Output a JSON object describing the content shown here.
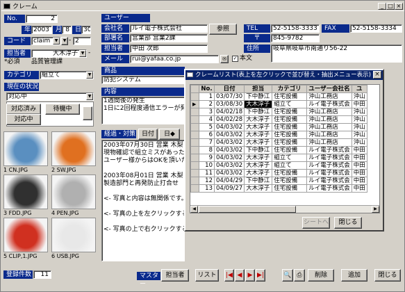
{
  "window": {
    "title": "クレーム"
  },
  "form": {
    "no_label": "No.",
    "no_value": "2",
    "year_label": "年",
    "year_value": "2003",
    "month_label": "月",
    "month_value": "8",
    "day_label": "日",
    "day_value": "30",
    "code_label": "コード",
    "code_value": "claim",
    "code_dash": "-",
    "code_num": "2",
    "tanto_label": "担当者",
    "tanto_value": "大木淳子",
    "tanto_dash": "-",
    "required_note": "*必須",
    "dept_value": "品質管理課",
    "category_label": "カテゴリ",
    "category_value": "組立て",
    "status_label": "現在の状況",
    "status_value": "対応中",
    "status_btn1": "対応済み",
    "status_btn2": "待機中",
    "status_btn3": "対応中"
  },
  "user": {
    "header": "ユーザー",
    "company_label": "会社名",
    "company_value": "ルイ電子株式会社",
    "ref_button": "参照",
    "dept_label": "部署名",
    "dept_value": "営業部 営業2課",
    "person_label": "担当者",
    "person_value": "中田 次郎",
    "mail_label": "メール",
    "mail_value": "rui@yafaa.co.jp",
    "honbun_label": "本文",
    "tel_label": "TEL",
    "tel_value": "52-5158-3333",
    "fax_label": "FAX",
    "fax_value": "52-5158-3334",
    "zip_label": "〒",
    "zip_value": "845-9782",
    "addr_label": "住所",
    "addr_value": "岐阜県岐阜市南通り56-22"
  },
  "product": {
    "header": "商品",
    "value": "防犯システム"
  },
  "content": {
    "header": "内容",
    "line1": "1週間後の発生",
    "line2": "1日に2回程度通信エラーが発"
  },
  "history": {
    "header": "経過・対策",
    "date_btn": "日付",
    "tanto_btn": "日◆",
    "lines": [
      "2003年07月30日 営業 木梨",
      "現物確認で組立ミスがあった。",
      "ユーザー様からはOKを頂いた",
      "",
      "2003年08月01日 営業 木梨",
      "製造部門と再発防止打合せ",
      "",
      "<- 写真と内容は無関係です。",
      "",
      "<- 写真の上を左クリックする",
      "",
      "<- 写真の上で右クリックする"
    ]
  },
  "photos": [
    {
      "caption": "1 CN.JPG",
      "color": "#5a8fc0"
    },
    {
      "caption": "2 SW.JPG",
      "color": "#e07020"
    },
    {
      "caption": "3 FDD.JPG",
      "color": "#303030"
    },
    {
      "caption": "4 PEN.JPG",
      "color": "#b0b0b0"
    },
    {
      "caption": "5 CLIP,1.JPG",
      "color": "#d03020"
    },
    {
      "caption": "6 USB.JPG",
      "color": "#e8e8e8"
    }
  ],
  "footer": {
    "count_label": "登録件数",
    "count_value": "11",
    "master_label": "マスター",
    "tanto_btn": "担当者",
    "list_btn": "リスト",
    "delete_btn": "削除",
    "add_btn": "追加",
    "close_btn": "閉じる"
  },
  "popup": {
    "title": "クレームリスト(表上を左クリックで並び替え・抽出メニュー表示)",
    "columns": [
      "No.",
      "日付",
      "担当",
      "カテゴリ",
      "ユーザー会社名",
      "ユ"
    ],
    "rows": [
      [
        "1",
        "03/07/30",
        "下中静江",
        "住宅設備",
        "沖山工務店",
        "沖山"
      ],
      [
        "2",
        "03/08/30",
        "大木淳子",
        "組立て",
        "ルイ電子株式会",
        "中田"
      ],
      [
        "3",
        "04/02/18",
        "下中静江",
        "住宅設備",
        "沖山工務店",
        "沖山"
      ],
      [
        "4",
        "04/02/28",
        "大木淳子",
        "住宅設備",
        "沖山工務店",
        "沖山"
      ],
      [
        "5",
        "04/03/02",
        "大木淳子",
        "住宅設備",
        "沖山工務店",
        "沖山"
      ],
      [
        "6",
        "04/03/02",
        "大木淳子",
        "住宅設備",
        "沖山工務店",
        "沖山"
      ],
      [
        "7",
        "04/03/02",
        "大木淳子",
        "住宅設備",
        "沖山工務店",
        "沖山"
      ],
      [
        "8",
        "04/03/02",
        "下中静江",
        "住宅設備",
        "ルイ電子株式会",
        "中田"
      ],
      [
        "9",
        "04/03/02",
        "大木淳子",
        "組立て",
        "ルイ電子株式会",
        "中田"
      ],
      [
        "10",
        "04/03/02",
        "大木淳子",
        "組立て",
        "ルイ電子株式会",
        "中田"
      ],
      [
        "11",
        "04/03/02",
        "大木淳子",
        "住宅設備",
        "ルイ電子株式会",
        "中田"
      ],
      [
        "12",
        "04/04/29",
        "下中静江",
        "住宅設備",
        "ルイ電子株式会",
        "中田"
      ],
      [
        "13",
        "04/09/27",
        "大木淳子",
        "住宅設備",
        "ルイ電子株式会",
        "中田"
      ]
    ],
    "seat_btn": "シートへ",
    "close_btn": "閉じる"
  }
}
